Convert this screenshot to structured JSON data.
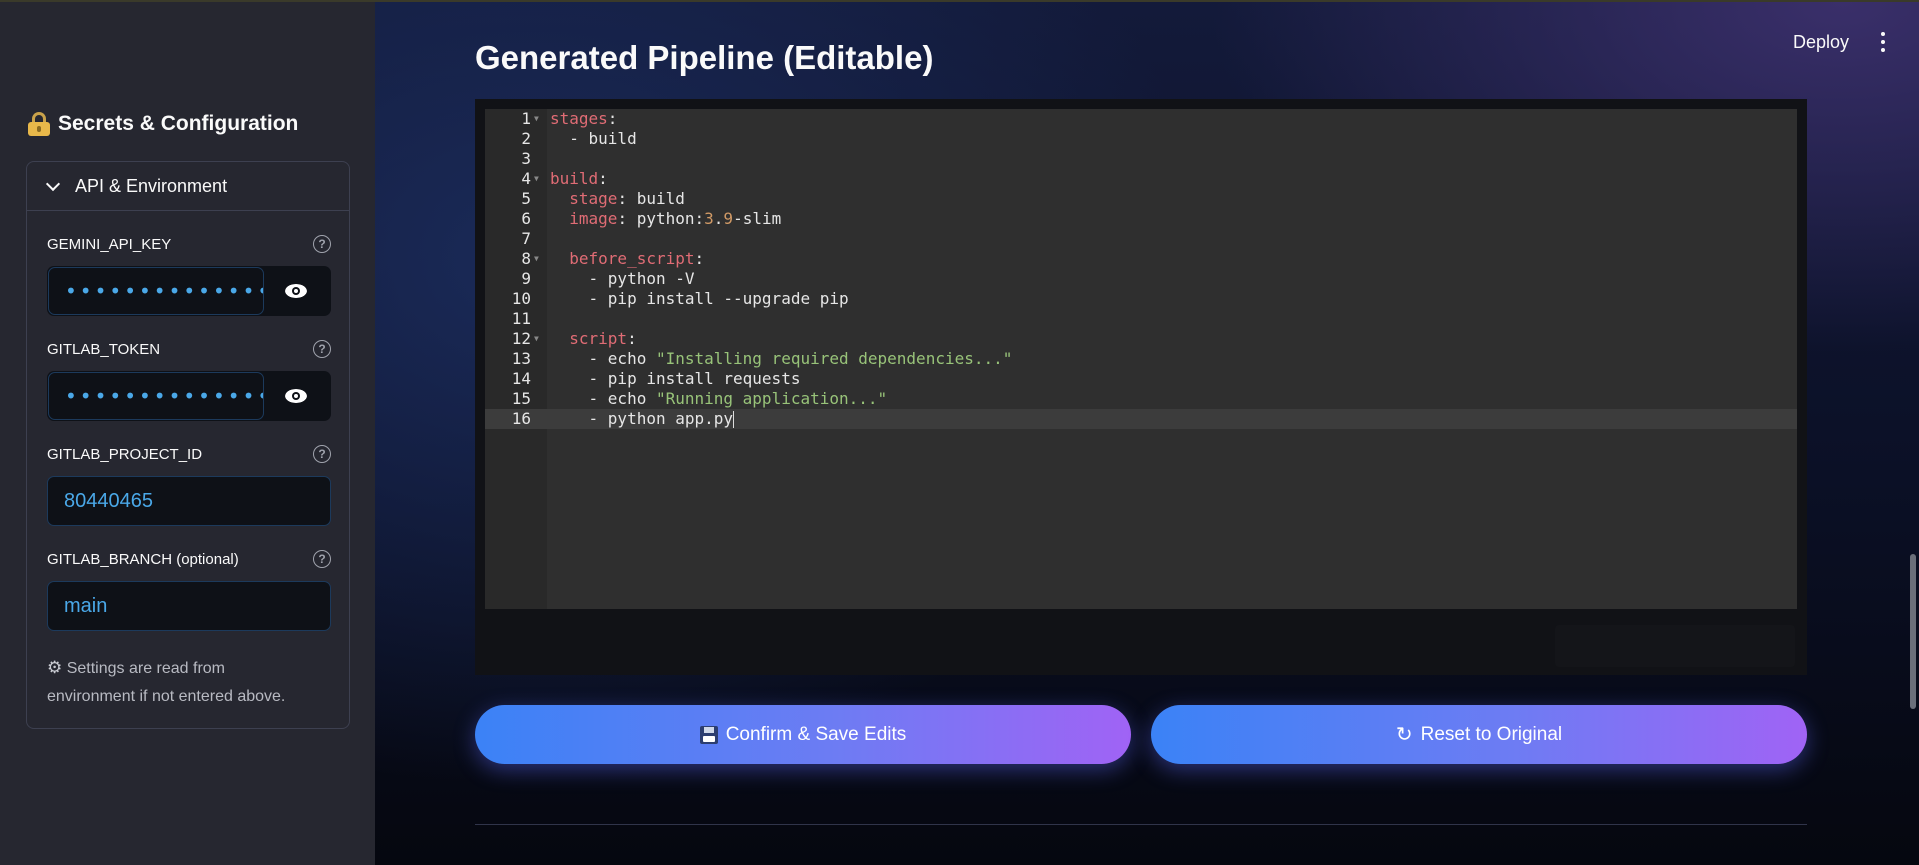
{
  "sidebar": {
    "title": "Secrets & Configuration",
    "expander": {
      "label": "API & Environment",
      "fields": [
        {
          "label": "GEMINI_API_KEY",
          "type": "password",
          "value": "••••••••••••••••••••"
        },
        {
          "label": "GITLAB_TOKEN",
          "type": "password",
          "value": "••••••••••••••••••••"
        },
        {
          "label": "GITLAB_PROJECT_ID",
          "type": "text",
          "value": "80440465"
        },
        {
          "label": "GITLAB_BRANCH (optional)",
          "type": "text",
          "value": "main"
        }
      ],
      "note": "Settings are read from environment if not entered above."
    }
  },
  "header": {
    "deploy_label": "Deploy"
  },
  "main": {
    "title": "Generated Pipeline (Editable)",
    "editor": {
      "language": "yaml",
      "active_line": 16,
      "lines": [
        "stages:",
        "  - build",
        "",
        "build:",
        "  stage: build",
        "  image: python:3.9-slim",
        "",
        "  before_script:",
        "    - python -V",
        "    - pip install --upgrade pip",
        "",
        "  script:",
        "    - echo \"Installing required dependencies...\"",
        "    - pip install requests",
        "    - echo \"Running application...\"",
        "    - python app.py"
      ]
    },
    "buttons": {
      "save_label": "Confirm & Save Edits",
      "reset_label": "Reset to Original"
    }
  },
  "colors": {
    "accent_gradient_start": "#3b82f6",
    "accent_gradient_end": "#a063f5",
    "input_text": "#4aa8e8",
    "yaml_key": "#e06c75",
    "yaml_string": "#98c379",
    "yaml_number": "#d19a66"
  }
}
